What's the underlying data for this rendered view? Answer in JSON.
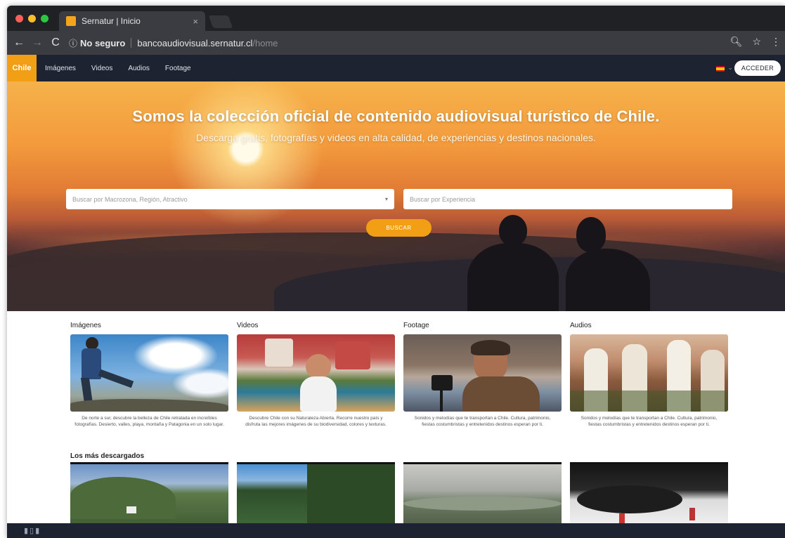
{
  "browser": {
    "tab_title": "Sernatur | Inicio",
    "tab_close": "×",
    "security_label": "No seguro",
    "url_host": "bancoaudiovisual.sernatur.cl",
    "url_path": "/home",
    "icons": [
      "back-icon",
      "forward-icon",
      "reload-icon",
      "info-icon",
      "zoom-icon",
      "star-icon",
      "menu-icon"
    ]
  },
  "site": {
    "logo": "Chile",
    "nav": [
      "Imágenes",
      "Videos",
      "Audios",
      "Footage"
    ],
    "login_label": "ACCEDER",
    "language_flag": "es",
    "colors": {
      "accent": "#f29f15",
      "header": "#1d2331"
    }
  },
  "hero": {
    "title": "Somos la colección oficial de contenido audiovisual turístico de Chile.",
    "subtitle": "Descarga gratis, fotografías y videos en alta calidad, de experiencias y destinos nacionales.",
    "search_region_placeholder": "Buscar por Macrozona, Región, Atractivo",
    "search_experience_placeholder": "Buscar por Experiencia",
    "search_button": "BUSCAR"
  },
  "categories": [
    {
      "title": "Imágenes",
      "description": "De norte a sur, descubre la belleza de Chile retratada en increíbles fotografías. Desierto, valles, playa, montaña y Patagonia en un solo lugar."
    },
    {
      "title": "Videos",
      "description": "Descubre Chile con su Naturaleza Abierta. Recorre nuestro país y disfruta las mejores imágenes de su biodiversidad, colores y texturas."
    },
    {
      "title": "Footage",
      "description": "Sonidos y melodías que te transportan a Chile. Cultura, patrimonio, fiestas costumbristas y entretenidos destinos esperan por ti."
    },
    {
      "title": "Audios",
      "description": "Sonidos y melodías que te transportan a Chile. Cultura, patrimonio, fiestas costumbristas y entretenidos destinos esperan por ti."
    }
  ],
  "most_downloaded": {
    "title": "Los más descargados"
  }
}
